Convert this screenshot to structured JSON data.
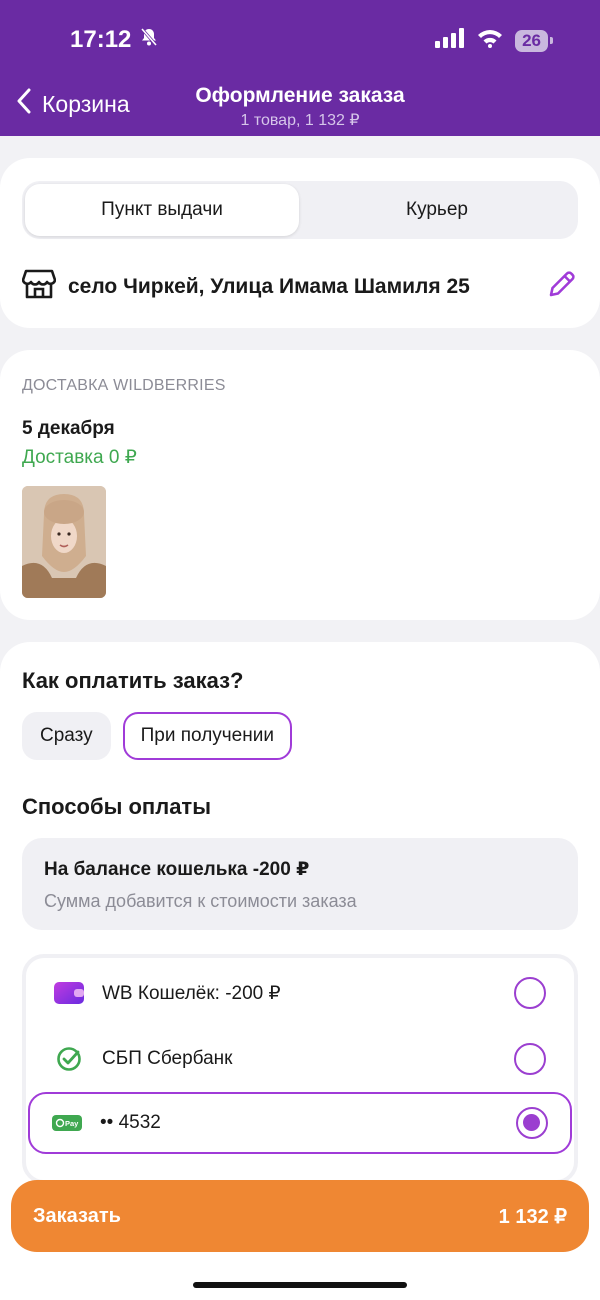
{
  "status": {
    "time": "17:12",
    "battery": "26"
  },
  "header": {
    "back_label": "Корзина",
    "title": "Оформление заказа",
    "subtitle": "1 товар, 1 132 ₽"
  },
  "pickup": {
    "tabs": [
      "Пункт выдачи",
      "Курьер"
    ],
    "active_tab": "Пункт выдачи",
    "address": "село Чиркей, Улица Имама Шамиля 25"
  },
  "delivery": {
    "label": "ДОСТАВКА WILDBERRIES",
    "date": "5 декабря",
    "price": "Доставка 0 ₽"
  },
  "payment": {
    "question": "Как оплатить заказ?",
    "options": [
      "Сразу",
      "При получении"
    ],
    "selected_option": "При получении",
    "methods_title": "Способы оплаты",
    "balance_title": "На балансе кошелька -200 ₽",
    "balance_subtitle": "Сумма добавится к стоимости заказа",
    "methods": [
      {
        "label": "WB Кошелёк: -200 ₽",
        "icon": "wallet-icon",
        "selected": false
      },
      {
        "label": "СБП Сбербанк",
        "icon": "sbp-check-icon",
        "selected": false
      },
      {
        "label": "•• 4532",
        "icon": "pay-card-icon",
        "selected": true
      }
    ]
  },
  "order": {
    "label": "Заказать",
    "total": "1 132 ₽"
  },
  "colors": {
    "header": "#6a2ba3",
    "accent": "#a03bd8",
    "order": "#ef8733",
    "green": "#3fa850"
  }
}
